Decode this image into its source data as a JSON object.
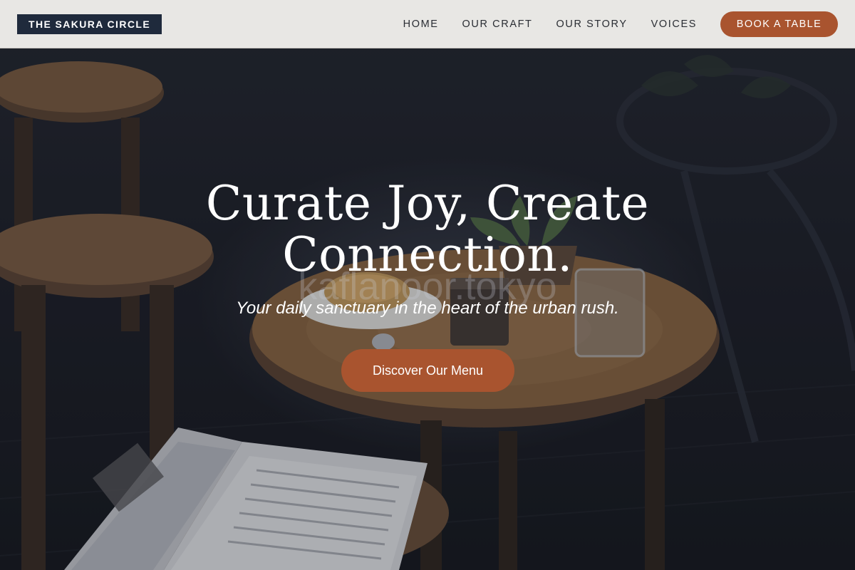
{
  "header": {
    "brand": "THE SAKURA CIRCLE",
    "nav": [
      {
        "label": "HOME"
      },
      {
        "label": "OUR CRAFT"
      },
      {
        "label": "OUR STORY"
      },
      {
        "label": "VOICES"
      }
    ],
    "cta_label": "BOOK A TABLE"
  },
  "hero": {
    "title_line1": "Curate Joy, Create",
    "title_line2": "Connection.",
    "tagline": "Your daily sanctuary in the heart of the urban rush.",
    "cta_label": "Discover Our Menu",
    "photo_watermark": "kaflanoor.tokyo"
  },
  "colors": {
    "accent": "#a9542f",
    "brand_bg": "#1f2a3c",
    "header_bg": "#f0efec",
    "hero_text": "#ffffff"
  },
  "icons": {
    "hero_image": "cafe-table-photo"
  }
}
